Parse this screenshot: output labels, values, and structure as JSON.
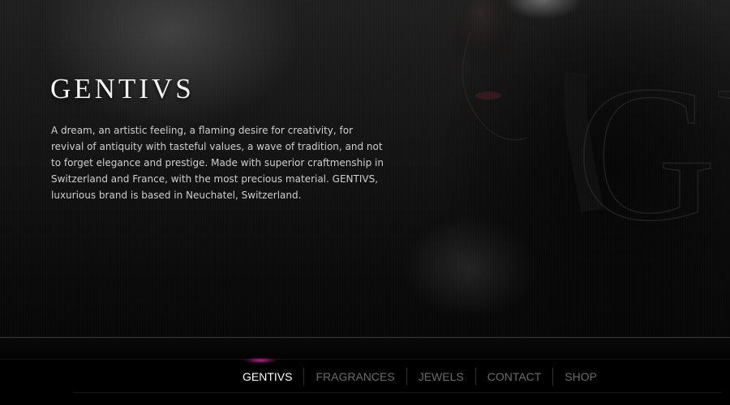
{
  "brand": {
    "title": "GENTIVS",
    "description": "A dream, an artistic feeling, a flaming desire for creativity, for revival of antiquity with tasteful values, a wave of tradition, and not to forget elegance and prestige. Made with superior craftmenship in Switzerland and France, with the most precious material. GENTIVS, luxurious brand is based in Neuchatel, Switzerland.",
    "monogram": "GV"
  },
  "nav": {
    "items": [
      {
        "label": "GENTIVS",
        "active": true
      },
      {
        "label": "FRAGRANCES",
        "active": false
      },
      {
        "label": "JEWELS",
        "active": false
      },
      {
        "label": "CONTACT",
        "active": false
      },
      {
        "label": "SHOP",
        "active": false
      }
    ]
  },
  "colors": {
    "background": "#0b0b0b",
    "title": "#f2f2f2",
    "body_text": "#cfcfcf",
    "nav_active": "#ffffff",
    "nav_inactive": "#6b6b6b",
    "accent_glow": "#c8289a"
  }
}
